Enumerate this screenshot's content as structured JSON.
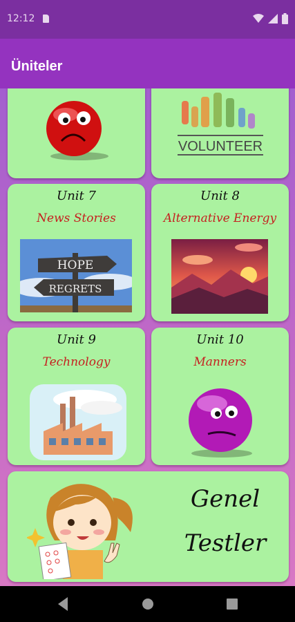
{
  "status_bar": {
    "time": "12:12"
  },
  "app_bar": {
    "title": "Üniteler"
  },
  "cards": [
    {
      "unit": "",
      "topic": "",
      "art": "sad-red-face"
    },
    {
      "unit": "",
      "topic": "",
      "art": "volunteer-hands",
      "art_text": "VOLUNTEER"
    },
    {
      "unit": "Unit 7",
      "topic": "News Stories",
      "art": "hope-regrets-signpost",
      "art_text": [
        "HOPE",
        "REGRETS"
      ]
    },
    {
      "unit": "Unit 8",
      "topic": "Alternative Energy",
      "art": "sunset-mountains"
    },
    {
      "unit": "Unit 9",
      "topic": "Technology",
      "art": "factory"
    },
    {
      "unit": "Unit 10",
      "topic": "Manners",
      "art": "purple-face"
    }
  ],
  "genel": {
    "line1": "Genel",
    "line2": "Testler",
    "art": "girl-with-test-paper"
  },
  "colors": {
    "card": "#abf2a0",
    "topic_red": "#c62020",
    "app_bar": "#9433bf",
    "status_bar": "#7b2fa0"
  },
  "nav": {
    "icons": [
      "back-icon",
      "home-icon",
      "recents-icon"
    ]
  }
}
